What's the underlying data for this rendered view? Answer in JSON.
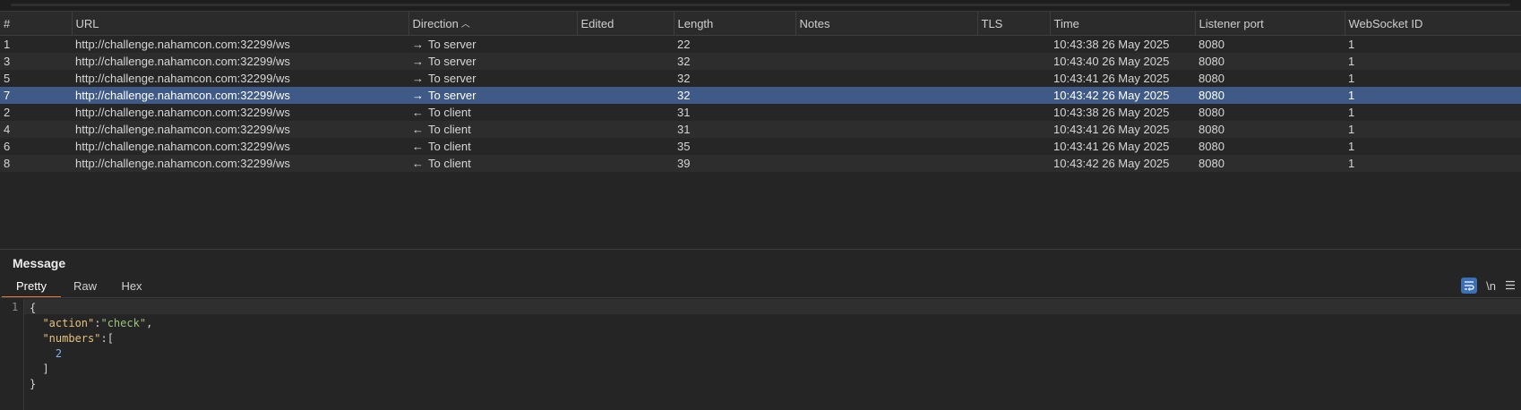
{
  "table": {
    "columns": [
      "#",
      "URL",
      "Direction",
      "Edited",
      "Length",
      "Notes",
      "TLS",
      "Time",
      "Listener port",
      "WebSocket ID"
    ],
    "sort_indicator": "^",
    "rows": [
      {
        "num": "1",
        "url": "http://challenge.nahamcon.com:32299/ws",
        "arrow": "→",
        "direction": "To server",
        "edited": "",
        "length": "22",
        "notes": "",
        "tls": "",
        "time": "10:43:38 26 May 2025",
        "port": "8080",
        "ws_id": "1",
        "selected": false
      },
      {
        "num": "3",
        "url": "http://challenge.nahamcon.com:32299/ws",
        "arrow": "→",
        "direction": "To server",
        "edited": "",
        "length": "32",
        "notes": "",
        "tls": "",
        "time": "10:43:40 26 May 2025",
        "port": "8080",
        "ws_id": "1",
        "selected": false
      },
      {
        "num": "5",
        "url": "http://challenge.nahamcon.com:32299/ws",
        "arrow": "→",
        "direction": "To server",
        "edited": "",
        "length": "32",
        "notes": "",
        "tls": "",
        "time": "10:43:41 26 May 2025",
        "port": "8080",
        "ws_id": "1",
        "selected": false
      },
      {
        "num": "7",
        "url": "http://challenge.nahamcon.com:32299/ws",
        "arrow": "→",
        "direction": "To server",
        "edited": "",
        "length": "32",
        "notes": "",
        "tls": "",
        "time": "10:43:42 26 May 2025",
        "port": "8080",
        "ws_id": "1",
        "selected": true
      },
      {
        "num": "2",
        "url": "http://challenge.nahamcon.com:32299/ws",
        "arrow": "←",
        "direction": "To client",
        "edited": "",
        "length": "31",
        "notes": "",
        "tls": "",
        "time": "10:43:38 26 May 2025",
        "port": "8080",
        "ws_id": "1",
        "selected": false
      },
      {
        "num": "4",
        "url": "http://challenge.nahamcon.com:32299/ws",
        "arrow": "←",
        "direction": "To client",
        "edited": "",
        "length": "31",
        "notes": "",
        "tls": "",
        "time": "10:43:41 26 May 2025",
        "port": "8080",
        "ws_id": "1",
        "selected": false
      },
      {
        "num": "6",
        "url": "http://challenge.nahamcon.com:32299/ws",
        "arrow": "←",
        "direction": "To client",
        "edited": "",
        "length": "35",
        "notes": "",
        "tls": "",
        "time": "10:43:41 26 May 2025",
        "port": "8080",
        "ws_id": "1",
        "selected": false
      },
      {
        "num": "8",
        "url": "http://challenge.nahamcon.com:32299/ws",
        "arrow": "←",
        "direction": "To client",
        "edited": "",
        "length": "39",
        "notes": "",
        "tls": "",
        "time": "10:43:42 26 May 2025",
        "port": "8080",
        "ws_id": "1",
        "selected": false
      }
    ]
  },
  "message": {
    "title": "Message",
    "tabs": [
      {
        "label": "Pretty",
        "active": true
      },
      {
        "label": "Raw",
        "active": false
      },
      {
        "label": "Hex",
        "active": false
      }
    ],
    "tools": {
      "wrap_icon": "wrap-lines-icon",
      "newline_label": "\\n",
      "menu_icon": "hamburger-menu-icon"
    },
    "line_number": "1",
    "body": {
      "open_brace": "{",
      "action_key": "\"action\"",
      "action_value": "\"check\"",
      "numbers_key": "\"numbers\"",
      "number_item": "2",
      "close_bracket": "]",
      "close_brace": "}"
    }
  },
  "colors": {
    "background": "#252526",
    "selected_row": "#3f5a86",
    "active_tab_underline": "#e07b3c",
    "json_key": "#e5c07b",
    "json_string": "#98c379",
    "json_number": "#7fb2f0",
    "wrap_button": "#3b6fb6"
  }
}
